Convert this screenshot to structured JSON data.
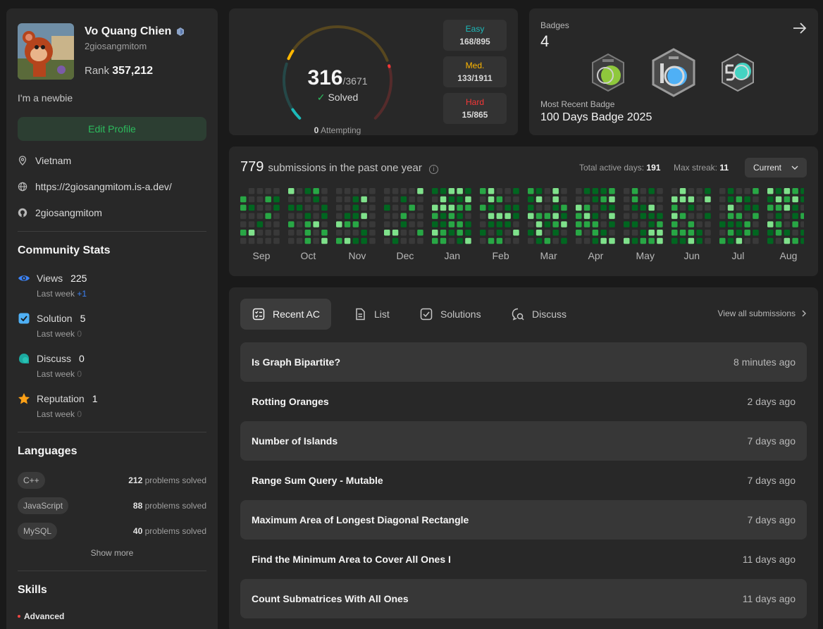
{
  "profile": {
    "name": "Vo Quang Chien",
    "handle": "2giosangmitom",
    "rank_label": "Rank",
    "rank_value": "357,212",
    "bio": "I'm a newbie",
    "edit_button": "Edit Profile",
    "location": "Vietnam",
    "website": "https://2giosangmitom.is-a.dev/",
    "github": "2giosangmitom"
  },
  "community": {
    "title": "Community Stats",
    "last_week_label": "Last week",
    "items": [
      {
        "label": "Views",
        "value": "225",
        "delta": "+1"
      },
      {
        "label": "Solution",
        "value": "5",
        "delta": "0"
      },
      {
        "label": "Discuss",
        "value": "0",
        "delta": "0"
      },
      {
        "label": "Reputation",
        "value": "1",
        "delta": "0"
      }
    ]
  },
  "languages": {
    "title": "Languages",
    "suffix": "problems solved",
    "items": [
      {
        "name": "C++",
        "count": "212"
      },
      {
        "name": "JavaScript",
        "count": "88"
      },
      {
        "name": "MySQL",
        "count": "40"
      }
    ],
    "show_more": "Show more"
  },
  "skills": {
    "title": "Skills",
    "first_level": "Advanced"
  },
  "progress": {
    "solved": "316",
    "total": "/3671",
    "solved_label": "Solved",
    "attempting_count": "0",
    "attempting_label": "Attempting",
    "difficulties": [
      {
        "name": "Easy",
        "value": "168/895",
        "color": "#1cbaba",
        "solved": 168,
        "total": 895
      },
      {
        "name": "Med.",
        "value": "133/1911",
        "color": "#ffb700",
        "solved": 133,
        "total": 1911
      },
      {
        "name": "Hard",
        "value": "15/865",
        "color": "#f63737",
        "solved": 15,
        "total": 865
      }
    ]
  },
  "badges": {
    "title": "Badges",
    "count": "4",
    "recent_label": "Most Recent Badge",
    "recent_name": "100 Days Badge 2025",
    "items": [
      "50-days-badge-icon",
      "100-days-badge-icon",
      "50-days-badge-2-icon"
    ]
  },
  "heatmap": {
    "count": "779",
    "title": "submissions in the past one year",
    "active_label": "Total active days:",
    "active_value": "191",
    "streak_label": "Max streak:",
    "streak_value": "11",
    "selector": "Current",
    "months": [
      "Sep",
      "Oct",
      "Nov",
      "Dec",
      "Jan",
      "Feb",
      "Mar",
      "Apr",
      "May",
      "Jun",
      "Jul",
      "Aug"
    ],
    "colors": [
      "#393939",
      "#016620",
      "#28a745",
      "#7fe18b"
    ]
  },
  "submissions": {
    "tabs": [
      {
        "label": "Recent AC",
        "icon": "recent-ac-icon"
      },
      {
        "label": "List",
        "icon": "list-icon"
      },
      {
        "label": "Solutions",
        "icon": "solutions-icon"
      },
      {
        "label": "Discuss",
        "icon": "discuss-icon"
      }
    ],
    "view_all": "View all submissions",
    "rows": [
      {
        "title": "Is Graph Bipartite?",
        "time": "8 minutes ago"
      },
      {
        "title": "Rotting Oranges",
        "time": "2 days ago"
      },
      {
        "title": "Number of Islands",
        "time": "7 days ago"
      },
      {
        "title": "Range Sum Query - Mutable",
        "time": "7 days ago"
      },
      {
        "title": "Maximum Area of Longest Diagonal Rectangle",
        "time": "7 days ago"
      },
      {
        "title": "Find the Minimum Area to Cover All Ones I",
        "time": "11 days ago"
      },
      {
        "title": "Count Submatrices With All Ones",
        "time": "11 days ago"
      }
    ]
  }
}
